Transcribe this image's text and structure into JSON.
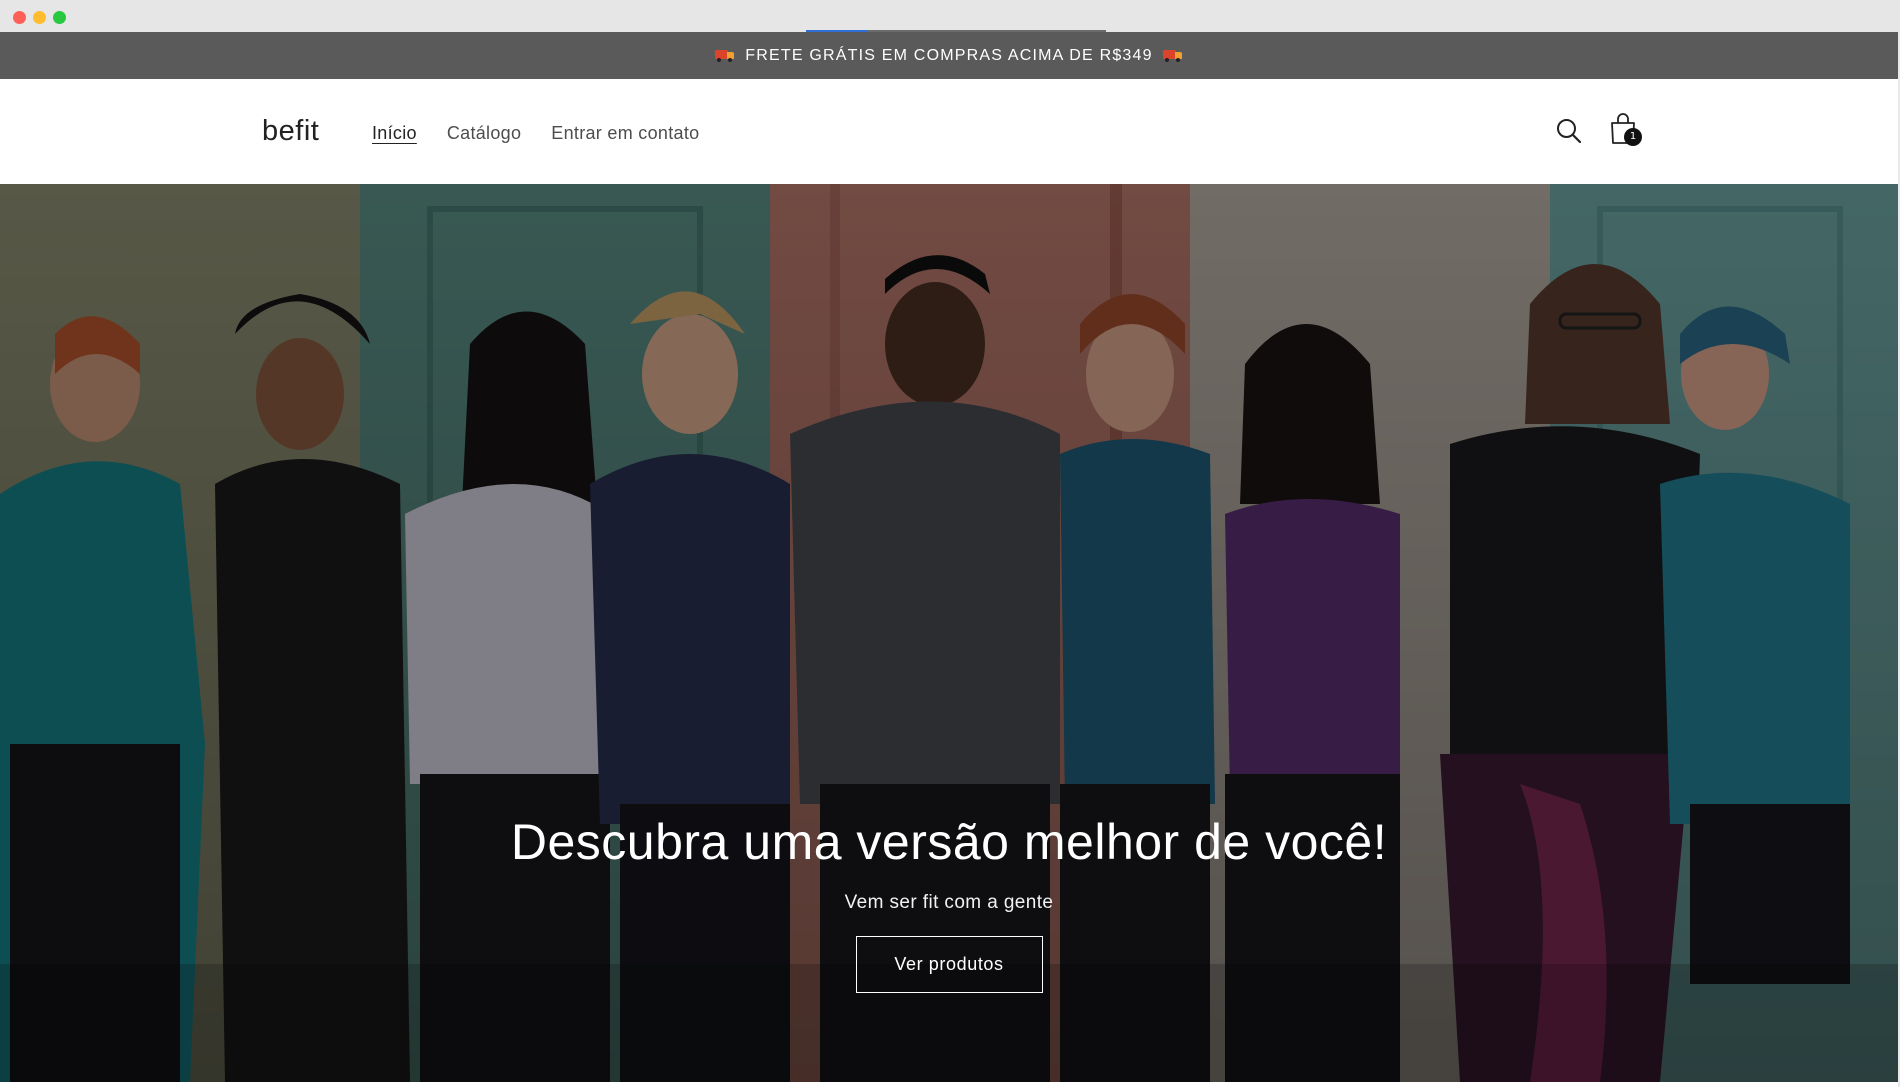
{
  "announcement": {
    "text": "FRETE GRÁTIS EM COMPRAS ACIMA DE R$349",
    "left_icon": "truck-emoji",
    "right_icon": "truck-emoji",
    "background": "#5a5a5a"
  },
  "header": {
    "logo": "befit",
    "nav": [
      {
        "label": "Início",
        "active": true
      },
      {
        "label": "Catálogo",
        "active": false
      },
      {
        "label": "Entrar em contato",
        "active": false
      }
    ],
    "search_icon": "search-icon",
    "cart_icon": "shopping-bag-icon",
    "cart_count": "1"
  },
  "hero": {
    "title": "Descubra uma versão melhor de você!",
    "subtitle": "Vem ser fit com a gente",
    "button_label": "Ver produtos"
  }
}
